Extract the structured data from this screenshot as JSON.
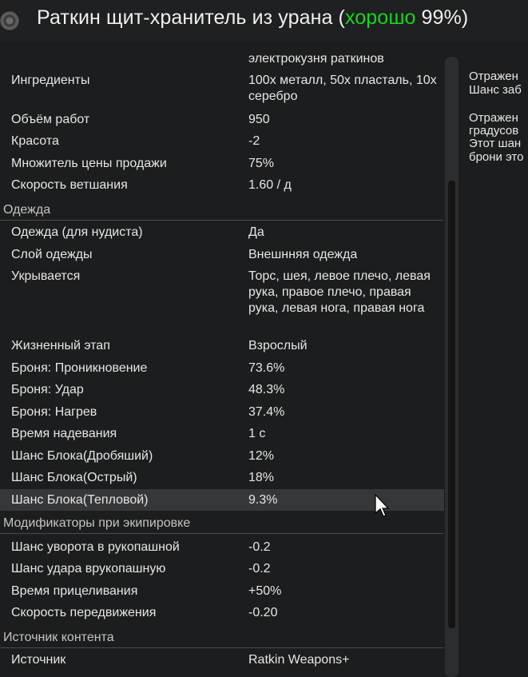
{
  "header": {
    "title_prefix": "Раткин щит-хранитель из урана (",
    "quality": "хорошо",
    "title_suffix": " 99%)",
    "quality_color": "#16d616"
  },
  "rows_top": [
    {
      "label": "",
      "value": "электрокузня раткинов"
    },
    {
      "label": "Ингредиенты",
      "value": "100x металл, 50x пласталь, 10x серебро"
    },
    {
      "label": "Объём работ",
      "value": "950"
    },
    {
      "label": "Красота",
      "value": "-2"
    },
    {
      "label": "Множитель цены продажи",
      "value": "75%"
    },
    {
      "label": "Скорость ветшания",
      "value": "1.60 / д"
    }
  ],
  "sections": {
    "apparel": "Одежда",
    "equip_mods": "Модификаторы при экипировке",
    "content_source": "Источник контента"
  },
  "apparel_rows": [
    {
      "label": "Одежда (для нудиста)",
      "value": "Да"
    },
    {
      "label": "Слой одежды",
      "value": "Внешнняя одежда"
    },
    {
      "label": "Укрывается",
      "value": "Торс, шея, левое плечо, левая рука, правое плечо, правая рука, левая нога, правая нога"
    },
    {
      "label": "Жизненный этап",
      "value": "Взрослый"
    },
    {
      "label": "Броня: Проникновение",
      "value": "73.6%"
    },
    {
      "label": "Броня: Удар",
      "value": "48.3%"
    },
    {
      "label": "Броня: Нагрев",
      "value": "37.4%"
    },
    {
      "label": "Время надевания",
      "value": "1 с"
    },
    {
      "label": "Шанс Блока(Дробяший)",
      "value": "12%"
    },
    {
      "label": "Шанс Блока(Острый)",
      "value": "18%"
    },
    {
      "label": "Шанс Блока(Тепловой)",
      "value": "9.3%"
    }
  ],
  "equip_rows": [
    {
      "label": "Шанс уворота в рукопашной",
      "value": "-0.2"
    },
    {
      "label": "Шанс удара врукопашную",
      "value": "-0.2"
    },
    {
      "label": "Время прицеливания",
      "value": "+50%"
    },
    {
      "label": "Скорость передвижения",
      "value": "-0.20"
    }
  ],
  "source_rows": [
    {
      "label": "Источник",
      "value": "Ratkin Weapons+"
    }
  ],
  "right_panel": [
    "Отражен",
    "Шанс заб",
    "",
    " Отражен",
    "градусов",
    "Этот шан",
    "брони это"
  ]
}
